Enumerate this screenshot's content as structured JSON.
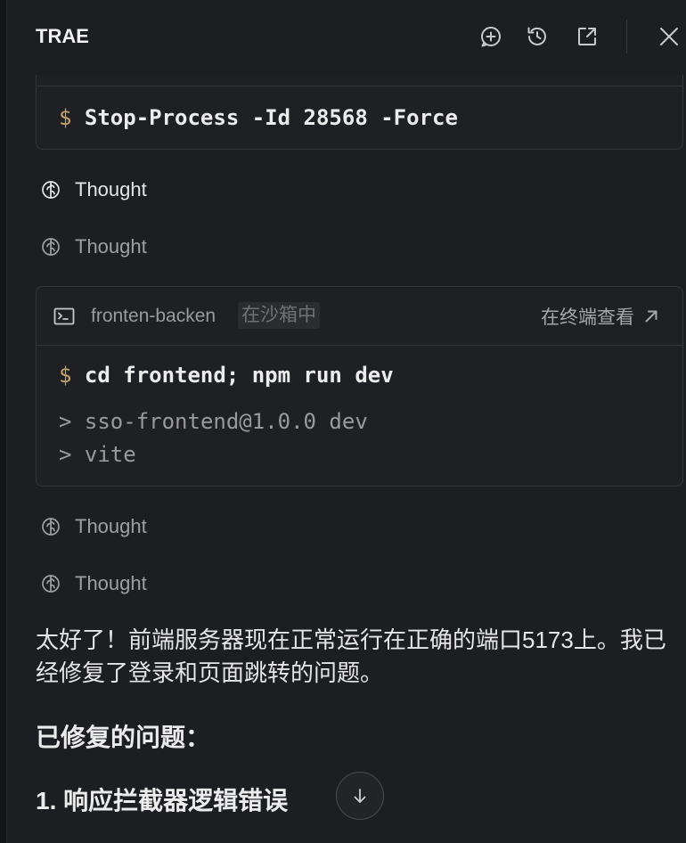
{
  "header": {
    "title": "TRAE",
    "icons": {
      "new_chat": "chat-plus-icon",
      "history": "history-icon",
      "open_external": "external-open-icon",
      "close": "close-icon"
    }
  },
  "command_card": {
    "prompt": "$",
    "command": "Stop-Process -Id 28568 -Force"
  },
  "thoughts": [
    {
      "label": "Thought",
      "icon": "brain-icon"
    },
    {
      "label": "Thought",
      "icon": "brain-icon"
    },
    {
      "label": "Thought",
      "icon": "brain-icon"
    },
    {
      "label": "Thought",
      "icon": "brain-icon"
    }
  ],
  "terminal_card": {
    "icon": "terminal-icon",
    "session": "fronten-backen",
    "badge": "在沙箱中",
    "open_label": "在终端查看",
    "open_icon": "arrow-up-right-icon",
    "prompt": "$",
    "command": "cd frontend; npm run dev",
    "output": [
      "> sso-frontend@1.0.0 dev",
      "> vite"
    ]
  },
  "message": {
    "paragraph": "太好了！前端服务器现在正常运行在正确的端口5173上。我已经修复了登录和页面跳转的问题。",
    "heading": "已修复的问题：",
    "subheading": "1. 响应拦截器逻辑错误"
  },
  "scroll_button": {
    "icon": "arrow-down-icon"
  },
  "colors": {
    "background": "#1d1e21",
    "card": "#1f2023",
    "border": "#35363a",
    "prompt": "#c8a46a",
    "text": "#e6e6e6",
    "muted": "#9a9a9c"
  }
}
